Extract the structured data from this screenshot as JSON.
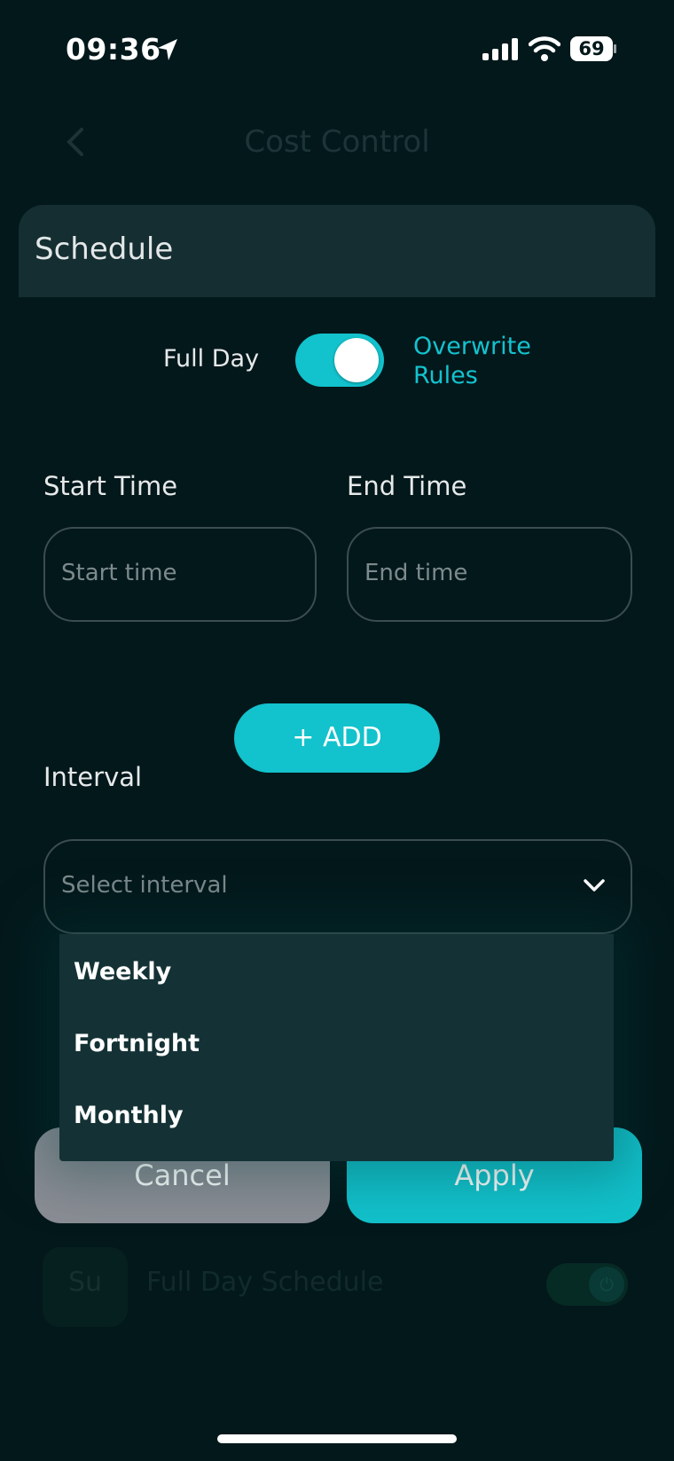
{
  "status_bar": {
    "time": "09:36",
    "battery": "69"
  },
  "nav": {
    "title": "Cost Control"
  },
  "sheet": {
    "title": "Schedule",
    "full_day_label": "Full Day",
    "full_day_on": true,
    "overwrite_rules_label": "Overwrite Rules",
    "start_time": {
      "label": "Start Time",
      "placeholder": "Start time"
    },
    "end_time": {
      "label": "End Time",
      "placeholder": "End time"
    },
    "add_label": "+ ADD",
    "interval": {
      "label": "Interval",
      "placeholder": "Select interval",
      "options": [
        "Weekly",
        "Fortnight",
        "Monthly"
      ]
    },
    "cancel_label": "Cancel",
    "apply_label": "Apply"
  },
  "background_list": {
    "day": "Su",
    "label": "Full Day Schedule"
  },
  "colors": {
    "accent": "#12c2cc",
    "background": "#03181b",
    "sheet_header": "#152e31",
    "cancel": "#8a8d94"
  }
}
